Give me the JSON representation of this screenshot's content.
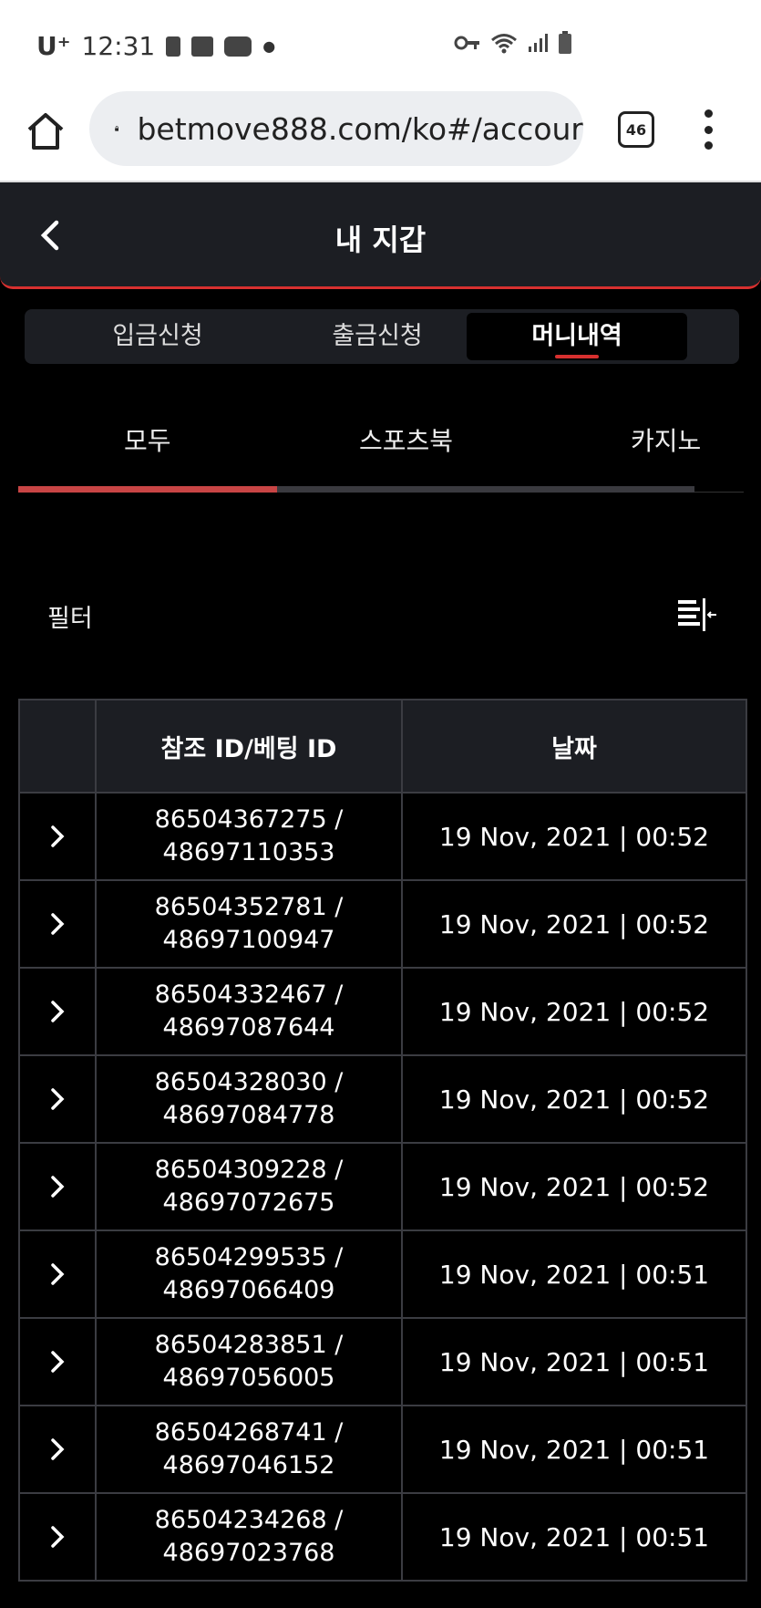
{
  "status_bar": {
    "time": "12:31",
    "carrier": "U⁺"
  },
  "browser": {
    "url": "betmove888.com/ko#/accour",
    "tab_count": "46"
  },
  "header": {
    "title": "내 지갑"
  },
  "main_tabs": [
    {
      "label": "입금신청",
      "active": false
    },
    {
      "label": "출금신청",
      "active": false
    },
    {
      "label": "머니내역",
      "active": true
    }
  ],
  "category_tabs": [
    {
      "label": "모두",
      "active": true
    },
    {
      "label": "스포츠북",
      "active": false
    },
    {
      "label": "카지노",
      "active": false
    }
  ],
  "filter": {
    "label": "필터"
  },
  "table": {
    "headers": {
      "id": "참조 ID/베팅 ID",
      "date": "날짜"
    },
    "rows": [
      {
        "ref": "86504367275 /",
        "bet": "48697110353",
        "date": "19 Nov, 2021 | 00:52"
      },
      {
        "ref": "86504352781 /",
        "bet": "48697100947",
        "date": "19 Nov, 2021 | 00:52"
      },
      {
        "ref": "86504332467 /",
        "bet": "48697087644",
        "date": "19 Nov, 2021 | 00:52"
      },
      {
        "ref": "86504328030 /",
        "bet": "48697084778",
        "date": "19 Nov, 2021 | 00:52"
      },
      {
        "ref": "86504309228 /",
        "bet": "48697072675",
        "date": "19 Nov, 2021 | 00:52"
      },
      {
        "ref": "86504299535 /",
        "bet": "48697066409",
        "date": "19 Nov, 2021 | 00:51"
      },
      {
        "ref": "86504283851 /",
        "bet": "48697056005",
        "date": "19 Nov, 2021 | 00:51"
      },
      {
        "ref": "86504268741 /",
        "bet": "48697046152",
        "date": "19 Nov, 2021 | 00:51"
      },
      {
        "ref": "86504234268 /",
        "bet": "48697023768",
        "date": "19 Nov, 2021 | 00:51"
      }
    ]
  },
  "colors": {
    "accent": "#d7302f",
    "panel": "#1c1e23",
    "background": "#000000"
  }
}
